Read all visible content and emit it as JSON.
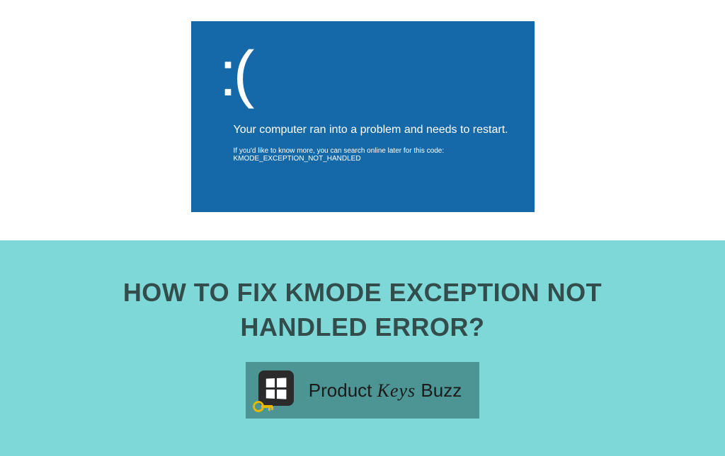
{
  "bsod": {
    "face": ":(",
    "main_text": "Your computer ran into a problem and needs to restart.",
    "sub_text": "If you'd like to know more, you can search online later for this code: KMODE_EXCEPTION_NOT_HANDLED"
  },
  "headline": "HOW TO FIX KMODE EXCEPTION NOT HANDLED ERROR?",
  "logo": {
    "text_part1": "Product ",
    "text_part2": "Keys",
    "text_part3": " Buzz"
  }
}
